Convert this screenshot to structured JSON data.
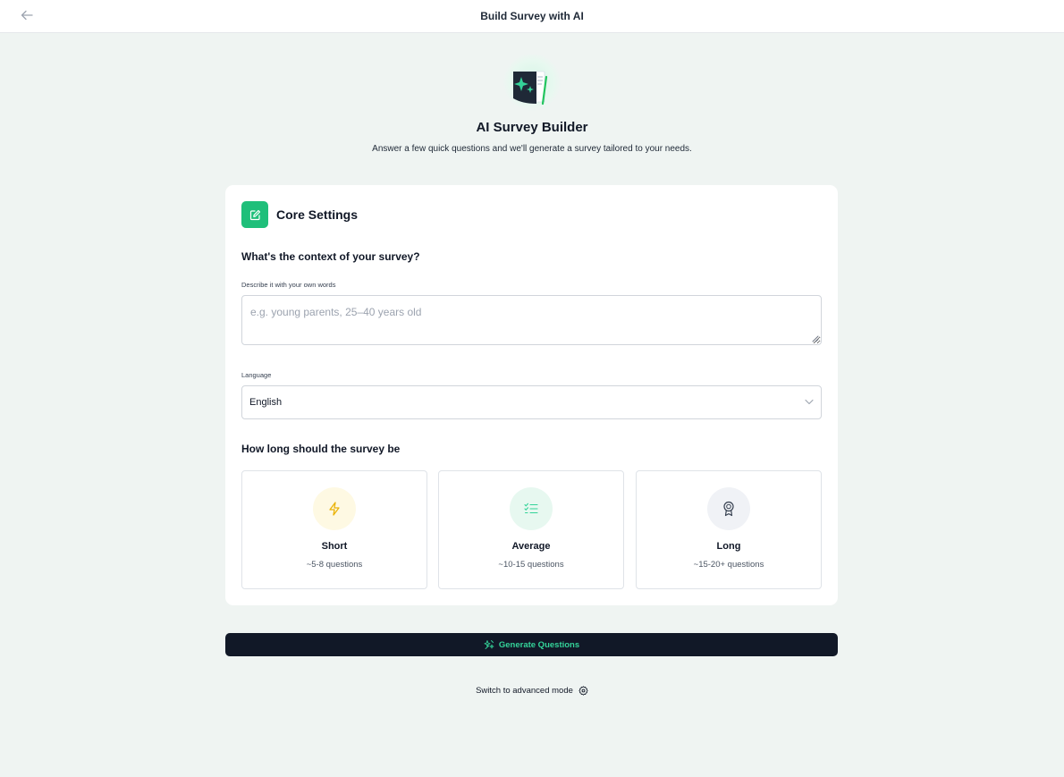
{
  "header": {
    "title": "Build Survey with AI"
  },
  "hero": {
    "title": "AI Survey Builder",
    "subtitle": "Answer a few quick questions and we'll generate a survey tailored to your needs."
  },
  "core": {
    "title": "Core Settings",
    "context_question": "What's the context of your survey?",
    "context_label": "Describe it with your own words",
    "context_value": "",
    "context_placeholder": "e.g. young parents, 25–40 years old",
    "language_label": "Language",
    "language_value": "English"
  },
  "length": {
    "title": "How long should the survey be",
    "options": [
      {
        "name": "Short",
        "desc": "~5-8 questions",
        "icon": "lightning-icon",
        "color": "#eab308"
      },
      {
        "name": "Average",
        "desc": "~10-15 questions",
        "icon": "checklist-icon",
        "color": "#34d399"
      },
      {
        "name": "Long",
        "desc": "~15-20+ questions",
        "icon": "award-icon",
        "color": "#374151"
      }
    ]
  },
  "actions": {
    "generate_label": "Generate Questions",
    "advanced_label": "Switch to advanced mode"
  },
  "colors": {
    "accent": "#1fbf7a",
    "dark": "#111827",
    "background": "#eff4f2"
  }
}
